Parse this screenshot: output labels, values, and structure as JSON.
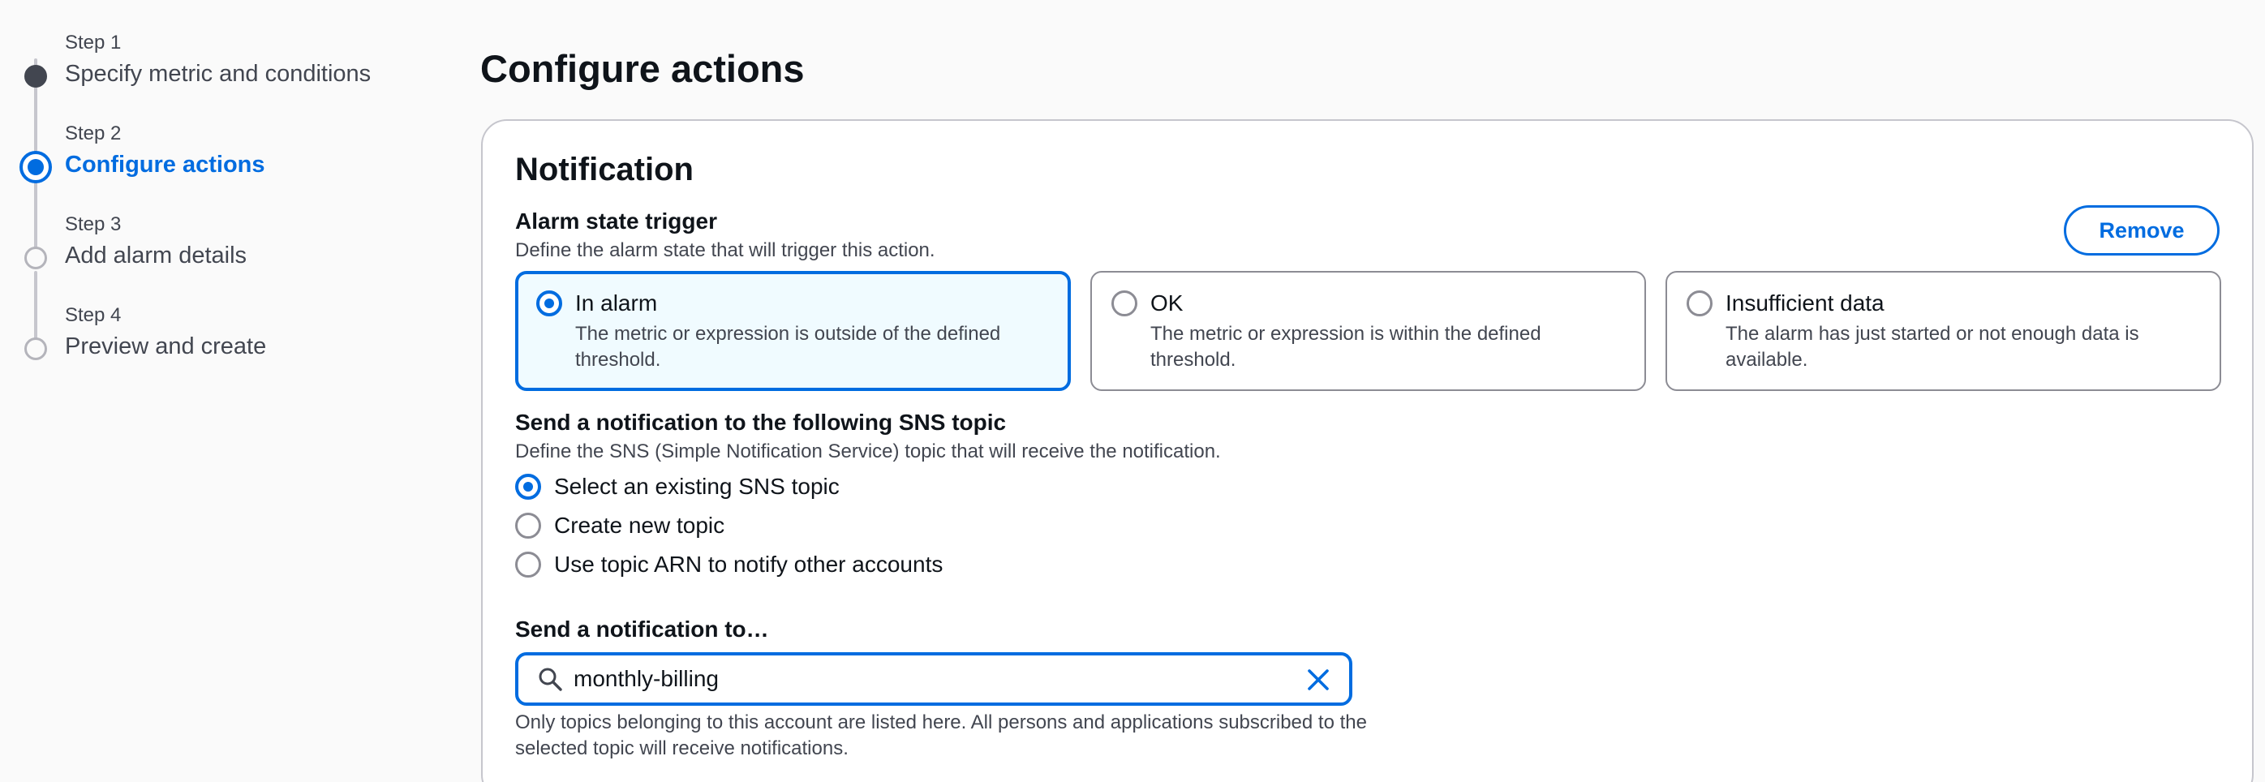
{
  "wizard": {
    "steps": [
      {
        "number": "Step 1",
        "title": "Specify metric and conditions",
        "state": "done"
      },
      {
        "number": "Step 2",
        "title": "Configure actions",
        "state": "current"
      },
      {
        "number": "Step 3",
        "title": "Add alarm details",
        "state": "upcoming"
      },
      {
        "number": "Step 4",
        "title": "Preview and create",
        "state": "upcoming"
      }
    ]
  },
  "main": {
    "title": "Configure actions",
    "notification": {
      "title": "Notification",
      "remove_label": "Remove",
      "alarm_state": {
        "label": "Alarm state trigger",
        "description": "Define the alarm state that will trigger this action.",
        "options": [
          {
            "title": "In alarm",
            "description": "The metric or expression is outside of the defined threshold.",
            "selected": true
          },
          {
            "title": "OK",
            "description": "The metric or expression is within the defined threshold.",
            "selected": false
          },
          {
            "title": "Insufficient data",
            "description": "The alarm has just started or not enough data is available.",
            "selected": false
          }
        ]
      },
      "sns": {
        "label": "Send a notification to the following SNS topic",
        "description": "Define the SNS (Simple Notification Service) topic that will receive the notification.",
        "options": [
          {
            "label": "Select an existing SNS topic",
            "checked": true
          },
          {
            "label": "Create new topic",
            "checked": false
          },
          {
            "label": "Use topic ARN to notify other accounts",
            "checked": false
          }
        ]
      },
      "send_to": {
        "label": "Send a notification to…",
        "value": "monthly-billing",
        "hint": "Only topics belonging to this account are listed here. All persons and applications subscribed to the selected topic will receive notifications."
      }
    }
  },
  "colors": {
    "accent": "#006ce0",
    "selected_tile_bg": "#f0fbff",
    "text": "#0f141a",
    "muted": "#424650"
  },
  "icons": {
    "search": "search-icon",
    "clear": "close-icon"
  }
}
